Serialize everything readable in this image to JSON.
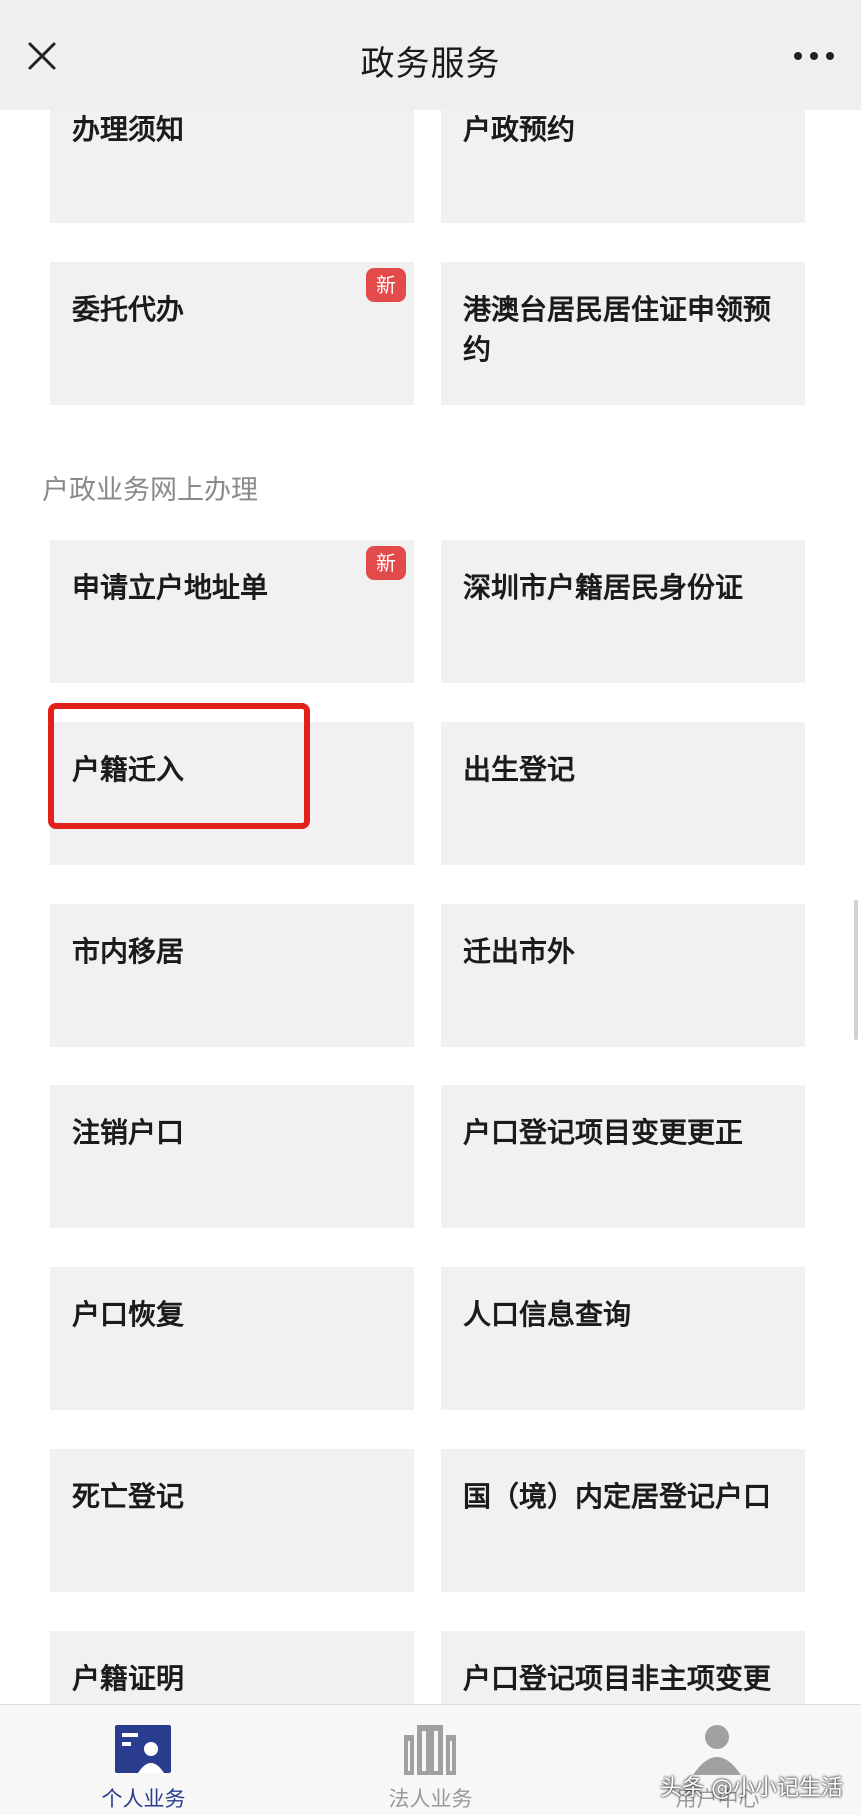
{
  "header": {
    "title": "政务服务",
    "close_icon": "close-icon",
    "more_icon": "more-dots-icon"
  },
  "cards_top": [
    {
      "label": "办理须知"
    },
    {
      "label": "户政预约"
    },
    {
      "label": "委托代办",
      "badge": "新"
    },
    {
      "label": "港澳台居民居住证申领预约"
    }
  ],
  "section": {
    "heading": "户政业务网上办理"
  },
  "cards_main": [
    {
      "label": "申请立户地址单",
      "badge": "新"
    },
    {
      "label": "深圳市户籍居民身份证"
    },
    {
      "label": "户籍迁入"
    },
    {
      "label": "出生登记"
    },
    {
      "label": "市内移居"
    },
    {
      "label": "迁出市外"
    },
    {
      "label": "注销户口"
    },
    {
      "label": "户口登记项目变更更正"
    },
    {
      "label": "户口恢复"
    },
    {
      "label": "人口信息查询"
    },
    {
      "label": "死亡登记"
    },
    {
      "label": "国（境）内定居登记户口"
    },
    {
      "label": "户籍证明"
    },
    {
      "label": "户口登记项目非主项变更"
    }
  ],
  "tabs": [
    {
      "label": "个人业务",
      "icon": "personal-id-card-icon",
      "active": true
    },
    {
      "label": "法人业务",
      "icon": "building-icon",
      "active": false
    },
    {
      "label": "用户中心",
      "icon": "user-avatar-icon",
      "active": false
    }
  ],
  "watermark": "头条 @小小记生活",
  "colors": {
    "badge": "#e34a4a",
    "highlight": "#e2211c",
    "active_tab": "#2a3d8f"
  }
}
